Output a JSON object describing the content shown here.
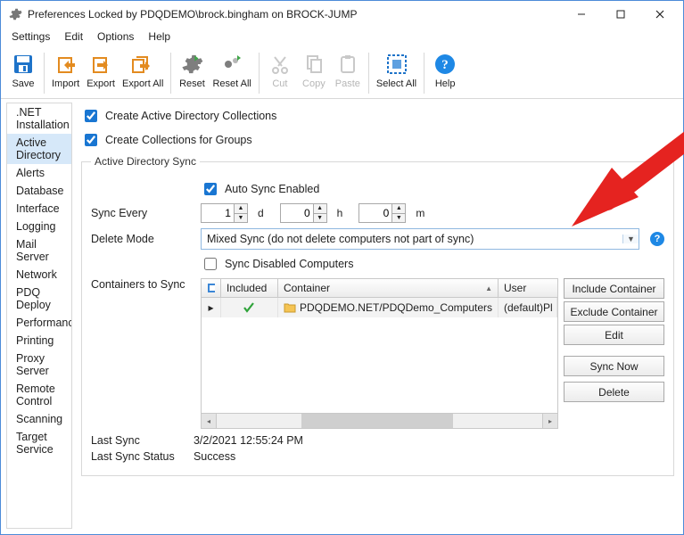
{
  "window": {
    "title": "Preferences Locked by PDQDEMO\\brock.bingham on BROCK-JUMP"
  },
  "menu": {
    "settings": "Settings",
    "edit": "Edit",
    "options": "Options",
    "help": "Help"
  },
  "toolbar": {
    "save": "Save",
    "import": "Import",
    "export": "Export",
    "exportAll": "Export All",
    "reset": "Reset",
    "resetAll": "Reset All",
    "cut": "Cut",
    "copy": "Copy",
    "paste": "Paste",
    "selectAll": "Select All",
    "help": "Help"
  },
  "sidebar": {
    "items": [
      ".NET Installation",
      "Active Directory",
      "Alerts",
      "Database",
      "Interface",
      "Logging",
      "Mail Server",
      "Network",
      "PDQ Deploy",
      "Performance",
      "Printing",
      "Proxy Server",
      "Remote Control",
      "Scanning",
      "Target Service"
    ],
    "selectedIndex": 1
  },
  "page": {
    "chkCreateCollections": "Create Active Directory Collections",
    "chkCreateGroups": "Create Collections for Groups",
    "groupTitle": "Active Directory Sync",
    "autoSync": "Auto Sync Enabled",
    "syncEveryLabel": "Sync Every",
    "sync_d": "1",
    "sync_h": "0",
    "sync_m": "0",
    "u_d": "d",
    "u_h": "h",
    "u_m": "m",
    "deleteModeLabel": "Delete Mode",
    "deleteModeValue": "Mixed Sync (do not delete computers not part of sync)",
    "syncDisabled": "Sync Disabled Computers",
    "containersLabel": "Containers to Sync",
    "col_included": "Included",
    "col_container": "Container",
    "col_user": "User",
    "row_container": "PDQDEMO.NET/PDQDemo_Computers",
    "row_user": "(default)Pl",
    "btn_include": "Include Container",
    "btn_exclude": "Exclude Container",
    "btn_edit": "Edit",
    "btn_syncnow": "Sync Now",
    "btn_delete": "Delete",
    "lastSyncLabel": "Last Sync",
    "lastSyncValue": "3/2/2021 12:55:24 PM",
    "lastSyncStatusLabel": "Last Sync Status",
    "lastSyncStatusValue": "Success"
  }
}
